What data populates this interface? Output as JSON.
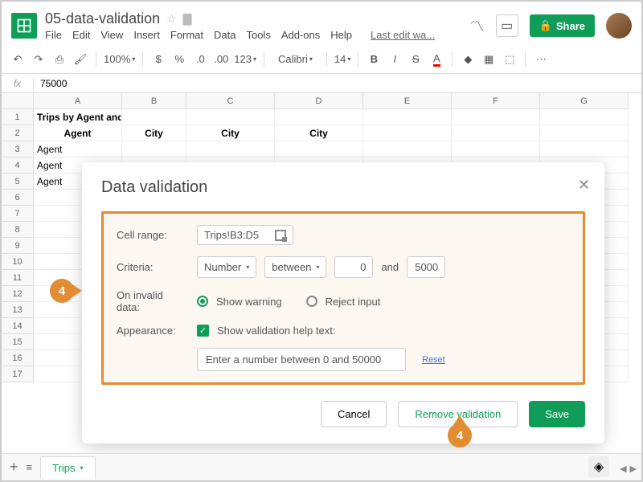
{
  "doc": {
    "title": "05-data-validation",
    "last_edit": "Last edit wa..."
  },
  "menu": {
    "file": "File",
    "edit": "Edit",
    "view": "View",
    "insert": "Insert",
    "format": "Format",
    "data": "Data",
    "tools": "Tools",
    "addons": "Add-ons",
    "help": "Help"
  },
  "toolbar": {
    "zoom": "100%",
    "currency": "$",
    "percent": "%",
    "dec_dec": ".0",
    "dec_inc": ".00",
    "numfmt": "123",
    "font": "Calibri",
    "size": "14",
    "bold": "B",
    "italic": "I",
    "strike": "S",
    "share": "Share"
  },
  "fx": {
    "value": "75000"
  },
  "columns": [
    "A",
    "B",
    "C",
    "D",
    "E",
    "F",
    "G"
  ],
  "rows": [
    "1",
    "2",
    "3",
    "4",
    "5",
    "6",
    "7",
    "8",
    "9",
    "10",
    "11",
    "12",
    "13",
    "14",
    "15",
    "16",
    "17"
  ],
  "cells": {
    "a1": "Trips by Agent and City",
    "a2": "Agent",
    "b2": "City",
    "c2": "City",
    "d2": "City",
    "a3": "Agent",
    "a4": "Agent",
    "a5": "Agent"
  },
  "dialog": {
    "title": "Data validation",
    "cell_range_label": "Cell range:",
    "cell_range": "Trips!B3:D5",
    "criteria_label": "Criteria:",
    "criteria_type": "Number",
    "criteria_op": "between",
    "criteria_lo": "0",
    "criteria_and": "and",
    "criteria_hi": "5000",
    "invalid_label": "On invalid data:",
    "show_warning": "Show warning",
    "reject_input": "Reject input",
    "appearance_label": "Appearance:",
    "help_text_label": "Show validation help text:",
    "help_text": "Enter a number between 0 and 50000",
    "reset": "Reset",
    "cancel": "Cancel",
    "remove": "Remove validation",
    "save": "Save"
  },
  "callout": "4",
  "sheet": {
    "name": "Trips",
    "plus": "+",
    "menu": "≡"
  }
}
